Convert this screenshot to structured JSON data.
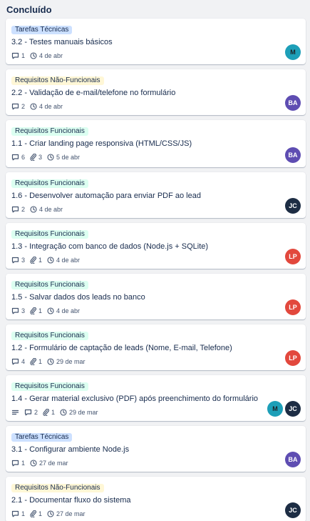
{
  "column": {
    "title": "Concluído"
  },
  "colors": {
    "green": "#dcfff1",
    "yellow": "#fff7d6",
    "blue": "#cce0ff"
  },
  "cards": [
    {
      "label": "Tarefas Técnicas",
      "label_color": "blue",
      "title": "3.2 - Testes manuais básicos",
      "comments": "1",
      "attachments": "",
      "date": "4 de abr",
      "avatars": [
        "M"
      ]
    },
    {
      "label": "Requisitos Não-Funcionais",
      "label_color": "yellow",
      "title": "2.2 - Validação de e-mail/telefone no formulário",
      "comments": "2",
      "attachments": "",
      "date": "4 de abr",
      "avatars": [
        "BA"
      ]
    },
    {
      "label": "Requisitos Funcionais",
      "label_color": "green",
      "title": "1.1 - Criar landing page responsiva (HTML/CSS/JS)",
      "comments": "6",
      "attachments": "3",
      "date": "5 de abr",
      "avatars": [
        "BA"
      ]
    },
    {
      "label": "Requisitos Funcionais",
      "label_color": "green",
      "title": "1.6 - Desenvolver automação para enviar PDF ao lead",
      "comments": "2",
      "attachments": "",
      "date": "4 de abr",
      "avatars": [
        "JC"
      ]
    },
    {
      "label": "Requisitos Funcionais",
      "label_color": "green",
      "title": "1.3 - Integração com banco de dados (Node.js + SQLite)",
      "comments": "3",
      "attachments": "1",
      "date": "4 de abr",
      "avatars": [
        "LP"
      ]
    },
    {
      "label": "Requisitos Funcionais",
      "label_color": "green",
      "title": "1.5 - Salvar dados dos leads no banco",
      "comments": "3",
      "attachments": "1",
      "date": "4 de abr",
      "avatars": [
        "LP"
      ]
    },
    {
      "label": "Requisitos Funcionais",
      "label_color": "green",
      "title": "1.2 - Formulário de captação de leads (Nome, E-mail, Telefone)",
      "comments": "4",
      "attachments": "1",
      "date": "29 de mar",
      "avatars": [
        "LP"
      ]
    },
    {
      "label": "Requisitos Funcionais",
      "label_color": "green",
      "title": "1.4 - Gerar material exclusivo (PDF) após preenchimento do formulário",
      "has_description": true,
      "comments": "2",
      "attachments": "1",
      "date": "29 de mar",
      "avatars": [
        "M",
        "JC"
      ]
    },
    {
      "label": "Tarefas Técnicas",
      "label_color": "blue",
      "title": "3.1 - Configurar ambiente Node.js",
      "comments": "1",
      "attachments": "",
      "date": "27 de mar",
      "avatars": [
        "BA"
      ]
    },
    {
      "label": "Requisitos Não-Funcionais",
      "label_color": "yellow",
      "title": "2.1 - Documentar fluxo do sistema",
      "comments": "1",
      "attachments": "1",
      "date": "27 de mar",
      "avatars": [
        "JC"
      ]
    }
  ]
}
